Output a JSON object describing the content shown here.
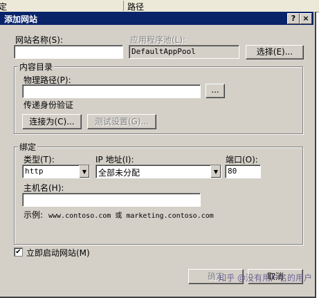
{
  "background_list": {
    "col1": "定",
    "col2": "路径"
  },
  "dialog": {
    "title": "添加网站",
    "help_label": "?",
    "close_label": "×"
  },
  "site_name": {
    "label": "网站名称(S):",
    "value": ""
  },
  "app_pool": {
    "label": "应用程序池(L):",
    "value": "DefaultAppPool",
    "select_button": "选择(E)..."
  },
  "content_dir": {
    "legend": "内容目录",
    "physical_path_label": "物理路径(P):",
    "physical_path_value": "",
    "browse_button": "...",
    "pass_through_label": "传递身份验证",
    "connect_as_button": "连接为(C)...",
    "test_settings_button": "测试设置(G)..."
  },
  "binding": {
    "legend": "绑定",
    "type_label": "类型(T):",
    "type_value": "http",
    "ip_label": "IP 地址(I):",
    "ip_value": "全部未分配",
    "port_label": "端口(O):",
    "port_value": "80",
    "host_label": "主机名(H):",
    "host_value": "",
    "example_prefix": "示例:",
    "example_text": "www.contoso.com 或 marketing.contoso.com"
  },
  "start_immediately": {
    "label": "立即启动网站(M)",
    "checked": true
  },
  "footer": {
    "ok_button": "确定",
    "cancel_button": "取消"
  },
  "watermark": "知乎 @没有用户名的用户"
}
